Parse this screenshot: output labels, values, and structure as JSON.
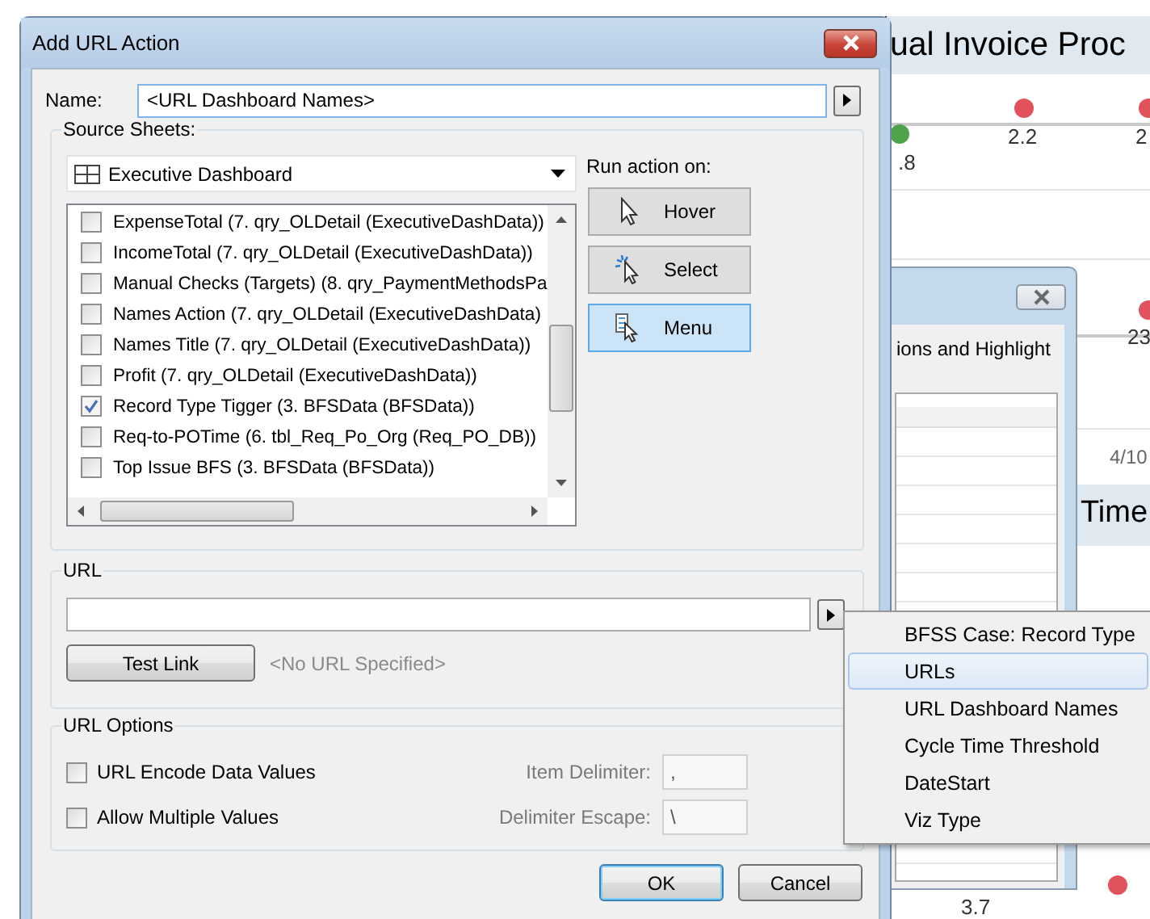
{
  "dashboard": {
    "title": "ual Invoice Proc",
    "marks": [
      {
        "label": ".8",
        "color": "#4fa34a"
      },
      {
        "label": "2.2",
        "color": "#e2525c"
      },
      {
        "label": "2",
        "color": "#e2525c"
      },
      {
        "label": "23",
        "color": "#e2525c"
      },
      {
        "label": "3.7"
      },
      {
        "color": "#e2525c"
      }
    ],
    "date_label": "4/10",
    "section_title": "Time"
  },
  "back_dialog": {
    "caption": "ions and Highlight"
  },
  "dialog": {
    "title": "Add URL Action",
    "name_label": "Name:",
    "name_value": "<URL Dashboard Names>",
    "source_sheets": {
      "legend": "Source Sheets:",
      "dropdown": "Executive Dashboard",
      "sheets": [
        {
          "label": "ExpenseTotal (7. qry_OLDetail (ExecutiveDashData))",
          "checked": false
        },
        {
          "label": "IncomeTotal (7. qry_OLDetail (ExecutiveDashData))",
          "checked": false
        },
        {
          "label": "Manual Checks (Targets) (8. qry_PaymentMethodsPa",
          "checked": false
        },
        {
          "label": "Names Action (7. qry_OLDetail (ExecutiveDashData)",
          "checked": false
        },
        {
          "label": "Names Title (7. qry_OLDetail (ExecutiveDashData))",
          "checked": false
        },
        {
          "label": "Profit (7. qry_OLDetail (ExecutiveDashData))",
          "checked": false
        },
        {
          "label": "Record Type Tigger (3. BFSData (BFSData))",
          "checked": true
        },
        {
          "label": "Req-to-POTime (6. tbl_Req_Po_Org (Req_PO_DB))",
          "checked": false
        },
        {
          "label": "Top Issue BFS (3. BFSData (BFSData))",
          "checked": false
        }
      ],
      "run_action_label": "Run action on:",
      "run_actions": [
        {
          "label": "Hover",
          "kind": "hover",
          "selected": false
        },
        {
          "label": "Select",
          "kind": "select",
          "selected": false
        },
        {
          "label": "Menu",
          "kind": "menu",
          "selected": true
        }
      ]
    },
    "url": {
      "legend": "URL",
      "test_button": "Test Link",
      "status": "<No URL Specified>"
    },
    "url_options": {
      "legend": "URL Options",
      "options": [
        {
          "label": "URL Encode Data Values",
          "checked": false
        },
        {
          "label": "Allow Multiple Values",
          "checked": false
        }
      ],
      "item_delimiter": {
        "label": "Item Delimiter:",
        "value": ","
      },
      "delimiter_escape": {
        "label": "Delimiter Escape:",
        "value": "\\"
      }
    },
    "buttons": [
      {
        "label": "OK",
        "default": true
      },
      {
        "label": "Cancel",
        "default": false
      }
    ]
  },
  "menu": {
    "items": [
      {
        "label": "BFSS Case: Record Type",
        "selected": false
      },
      {
        "label": "URLs",
        "selected": true
      },
      {
        "label": "URL Dashboard Names",
        "selected": false
      },
      {
        "label": "Cycle Time Threshold",
        "selected": false
      },
      {
        "label": "DateStart",
        "selected": false
      },
      {
        "label": "Viz Type",
        "selected": false
      }
    ]
  }
}
